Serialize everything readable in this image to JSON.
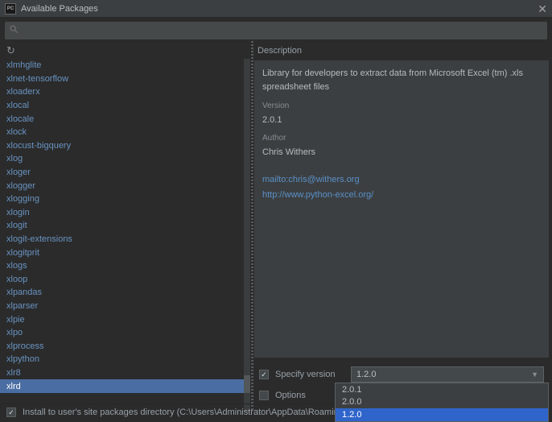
{
  "window": {
    "title": "Available Packages",
    "app_icon_text": "PC"
  },
  "search": {
    "placeholder": "",
    "value": ""
  },
  "packages": [
    "xlmhglite",
    "xlnet-tensorflow",
    "xloaderx",
    "xlocal",
    "xlocale",
    "xlock",
    "xlocust-bigquery",
    "xlog",
    "xloger",
    "xlogger",
    "xlogging",
    "xlogin",
    "xlogit",
    "xlogit-extensions",
    "xlogitprit",
    "xlogs",
    "xloop",
    "xlpandas",
    "xlparser",
    "xlpie",
    "xlpo",
    "xlprocess",
    "xlpython",
    "xlr8",
    "xlrd"
  ],
  "selected_index": 24,
  "description": {
    "header": "Description",
    "text": "Library for developers to extract data from Microsoft Excel (tm) .xls spreadsheet files",
    "version_label": "Version",
    "version": "2.0.1",
    "author_label": "Author",
    "author": "Chris Withers",
    "mailto": "mailto:chris@withers.org",
    "url": "http://www.python-excel.org/"
  },
  "controls": {
    "specify_version_label": "Specify version",
    "specify_version_checked": true,
    "selected_version": "1.2.0",
    "options_label": "Options",
    "options_checked": false
  },
  "version_dropdown": {
    "items": [
      "2.0.1",
      "2.0.0",
      "1.2.0"
    ],
    "highlighted_index": 2
  },
  "footer": {
    "install_checked": true,
    "install_label": "Install to user's site packages directory (C:\\Users\\Administrator\\AppData\\Roaming\\Pytl"
  }
}
